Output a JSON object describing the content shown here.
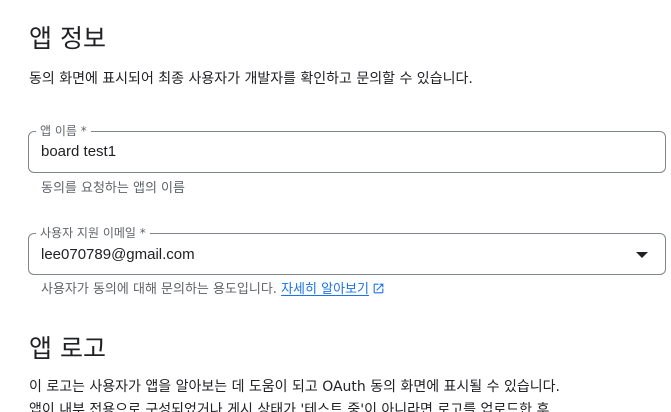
{
  "app_info": {
    "title": "앱 정보",
    "description": "동의 화면에 표시되어 최종 사용자가 개발자를 확인하고 문의할 수 있습니다.",
    "app_name_field": {
      "label": "앱 이름 *",
      "value": "board test1",
      "hint": "동의를 요청하는 앱의 이름"
    },
    "support_email_field": {
      "label": "사용자 지원 이메일 *",
      "value": "lee070789@gmail.com",
      "hint": "사용자가 동의에 대해 문의하는 용도입니다.",
      "learn_more_link": "자세히 알아보기"
    }
  },
  "app_logo": {
    "title": "앱 로고",
    "description_line1": "이 로고는 사용자가 앱을 알아보는 데 도움이 되고 OAuth 동의 화면에 표시될 수 있습니다.",
    "description_line2": "앱이 내부 전용으로 구성되었거나 게시 상태가 '테스트 중'이 아니라면 로고를 업로드한 후"
  },
  "icons": {
    "dropdown": "chevron-down-icon",
    "external_link": "open-in-new-icon"
  },
  "colors": {
    "link": "#1a73e8",
    "border": "#80868b",
    "hint_text": "#5f6368"
  }
}
